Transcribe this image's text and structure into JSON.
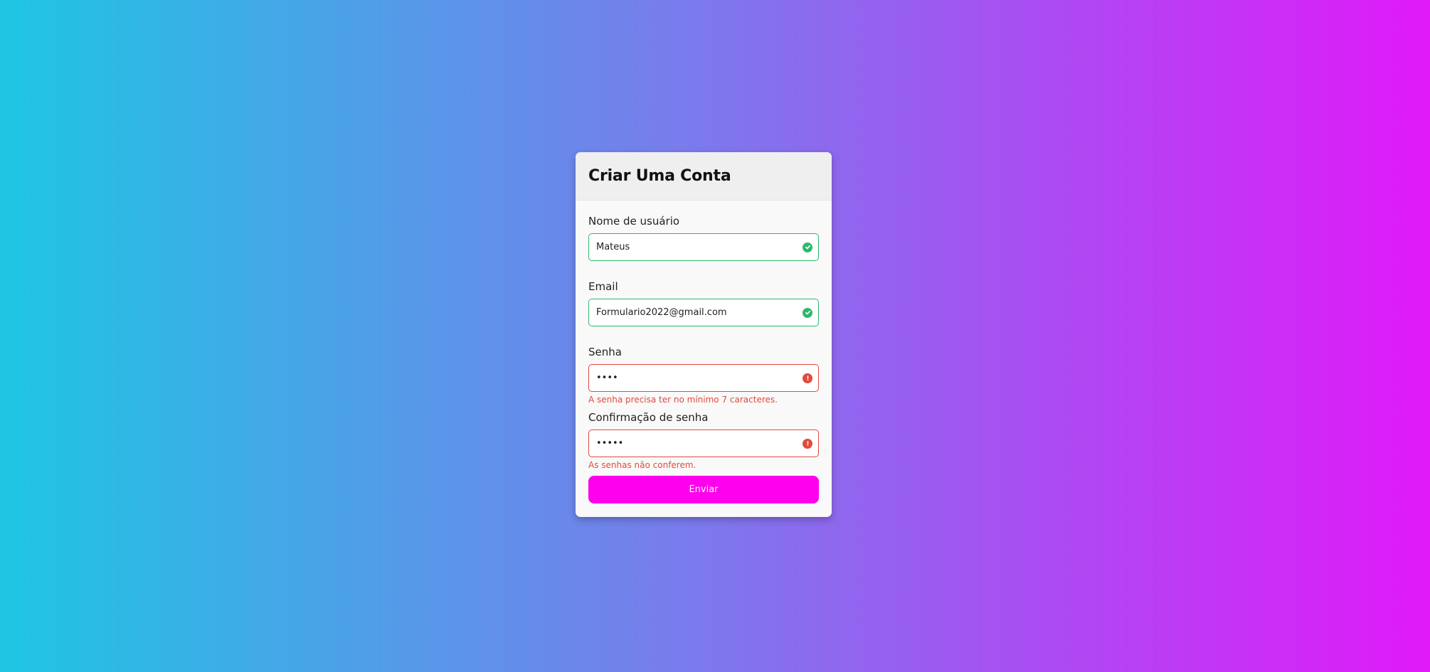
{
  "form": {
    "title": "Criar Uma Conta",
    "fields": [
      {
        "label": "Nome de usuário",
        "value": "Mateus",
        "type": "text",
        "status": "valid",
        "status_icon": "check-circle-icon",
        "error": ""
      },
      {
        "label": "Email",
        "value": "Formulario2022@gmail.com",
        "type": "text",
        "status": "valid",
        "status_icon": "check-circle-icon",
        "error": ""
      },
      {
        "label": "Senha",
        "value": "1234",
        "type": "password",
        "status": "error",
        "status_icon": "exclamation-circle-icon",
        "error": "A senha precisa ter no mínimo 7 caracteres."
      },
      {
        "label": "Confirmação de senha",
        "value": "12345",
        "type": "password",
        "status": "error",
        "status_icon": "exclamation-circle-icon",
        "error": "As senhas não conferem."
      }
    ],
    "submit_label": "Enviar"
  },
  "colors": {
    "gradient_start": "#1ec6e3",
    "gradient_end": "#e019f9",
    "valid": "#2fb86b",
    "error": "#e04b3d",
    "button": "#ff00ee"
  }
}
